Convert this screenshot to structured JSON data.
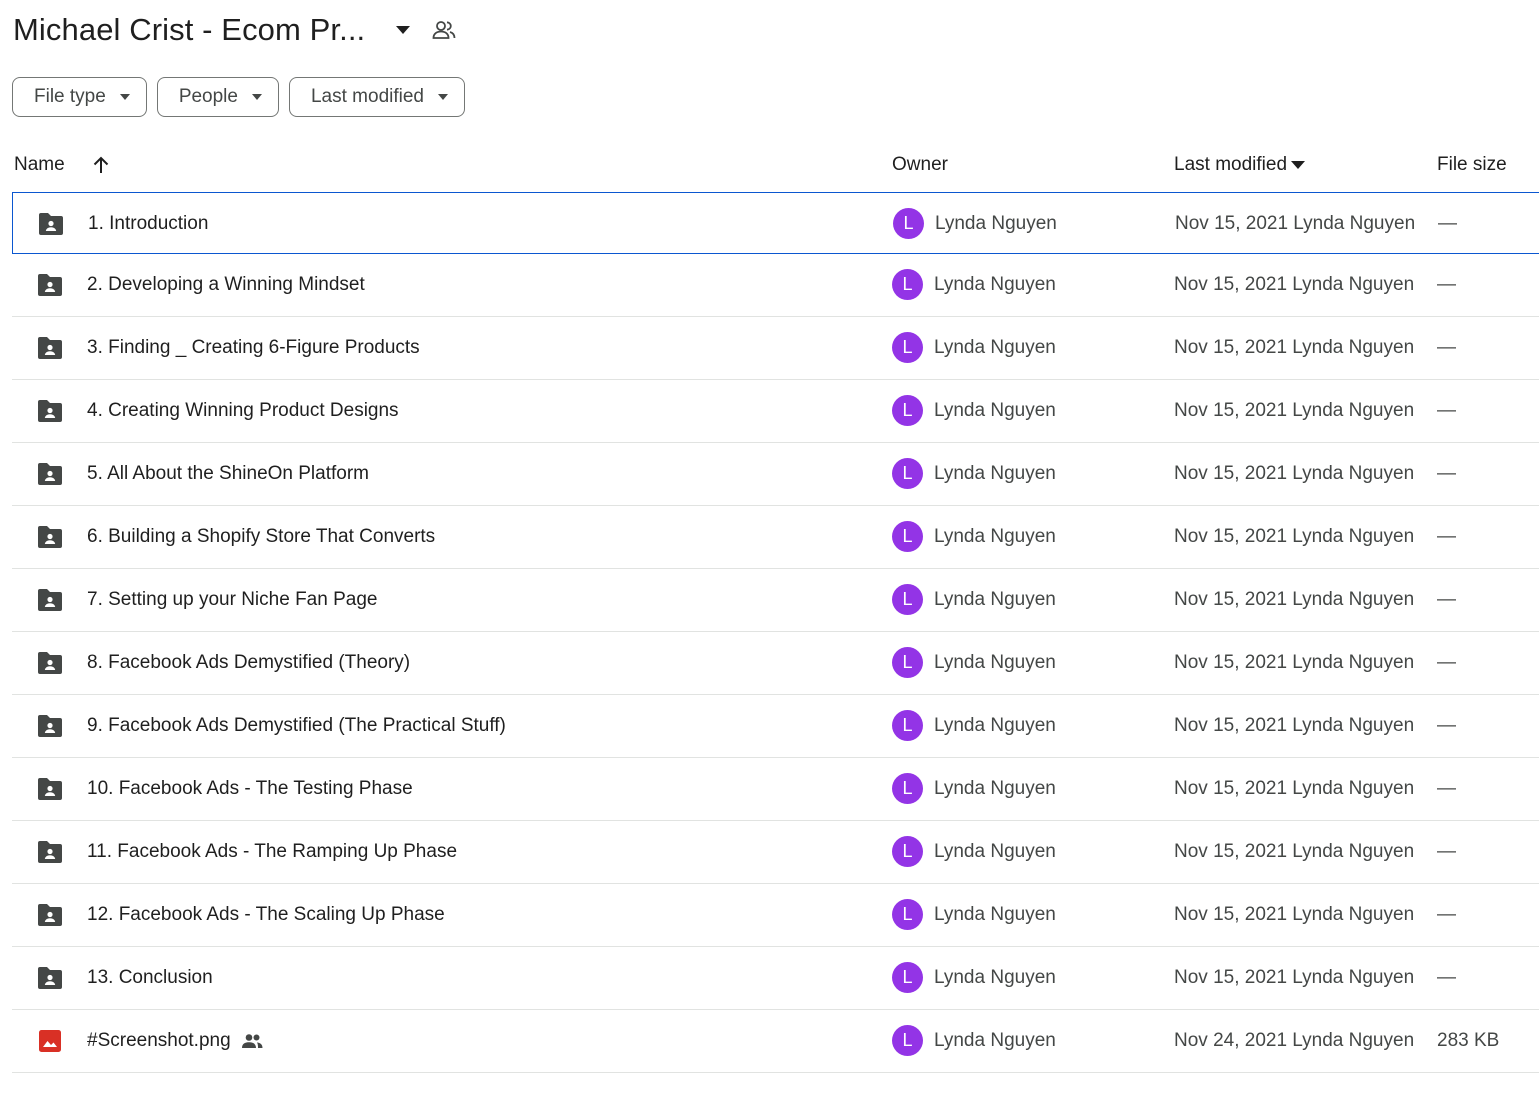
{
  "header": {
    "title": "Michael Crist - Ecom Pr..."
  },
  "filters": [
    {
      "label": "File type"
    },
    {
      "label": "People"
    },
    {
      "label": "Last modified"
    }
  ],
  "columns": {
    "name": "Name",
    "owner": "Owner",
    "last_modified": "Last modified",
    "file_size": "File size"
  },
  "colors": {
    "avatar": "#9334e6",
    "selected_border": "#0b57d0",
    "folder_icon": "#444746",
    "image_icon": "#d93025"
  },
  "rows": [
    {
      "name": "1. Introduction",
      "type": "shared-folder",
      "owner_initial": "L",
      "owner": "Lynda Nguyen",
      "modified": "Nov 15, 2021 Lynda Nguyen",
      "size": "—",
      "shared": false
    },
    {
      "name": "2. Developing a Winning Mindset",
      "type": "shared-folder",
      "owner_initial": "L",
      "owner": "Lynda Nguyen",
      "modified": "Nov 15, 2021 Lynda Nguyen",
      "size": "—",
      "shared": false
    },
    {
      "name": "3. Finding _ Creating 6-Figure Products",
      "type": "shared-folder",
      "owner_initial": "L",
      "owner": "Lynda Nguyen",
      "modified": "Nov 15, 2021 Lynda Nguyen",
      "size": "—",
      "shared": false
    },
    {
      "name": "4. Creating Winning Product Designs",
      "type": "shared-folder",
      "owner_initial": "L",
      "owner": "Lynda Nguyen",
      "modified": "Nov 15, 2021 Lynda Nguyen",
      "size": "—",
      "shared": false
    },
    {
      "name": "5. All About the ShineOn Platform",
      "type": "shared-folder",
      "owner_initial": "L",
      "owner": "Lynda Nguyen",
      "modified": "Nov 15, 2021 Lynda Nguyen",
      "size": "—",
      "shared": false
    },
    {
      "name": "6. Building a Shopify Store That Converts",
      "type": "shared-folder",
      "owner_initial": "L",
      "owner": "Lynda Nguyen",
      "modified": "Nov 15, 2021 Lynda Nguyen",
      "size": "—",
      "shared": false
    },
    {
      "name": "7. Setting up your Niche Fan Page",
      "type": "shared-folder",
      "owner_initial": "L",
      "owner": "Lynda Nguyen",
      "modified": "Nov 15, 2021 Lynda Nguyen",
      "size": "—",
      "shared": false
    },
    {
      "name": "8. Facebook Ads Demystified (Theory)",
      "type": "shared-folder",
      "owner_initial": "L",
      "owner": "Lynda Nguyen",
      "modified": "Nov 15, 2021 Lynda Nguyen",
      "size": "—",
      "shared": false
    },
    {
      "name": "9. Facebook Ads Demystified (The Practical Stuff)",
      "type": "shared-folder",
      "owner_initial": "L",
      "owner": "Lynda Nguyen",
      "modified": "Nov 15, 2021 Lynda Nguyen",
      "size": "—",
      "shared": false
    },
    {
      "name": "10. Facebook Ads - The Testing Phase",
      "type": "shared-folder",
      "owner_initial": "L",
      "owner": "Lynda Nguyen",
      "modified": "Nov 15, 2021 Lynda Nguyen",
      "size": "—",
      "shared": false
    },
    {
      "name": "11. Facebook Ads - The Ramping Up Phase",
      "type": "shared-folder",
      "owner_initial": "L",
      "owner": "Lynda Nguyen",
      "modified": "Nov 15, 2021 Lynda Nguyen",
      "size": "—",
      "shared": false
    },
    {
      "name": "12. Facebook Ads - The Scaling Up Phase",
      "type": "shared-folder",
      "owner_initial": "L",
      "owner": "Lynda Nguyen",
      "modified": "Nov 15, 2021 Lynda Nguyen",
      "size": "—",
      "shared": false
    },
    {
      "name": "13. Conclusion",
      "type": "shared-folder",
      "owner_initial": "L",
      "owner": "Lynda Nguyen",
      "modified": "Nov 15, 2021 Lynda Nguyen",
      "size": "—",
      "shared": false
    },
    {
      "name": "#Screenshot.png",
      "type": "image",
      "owner_initial": "L",
      "owner": "Lynda Nguyen",
      "modified": "Nov 24, 2021 Lynda Nguyen",
      "size": "283 KB",
      "shared": true
    }
  ]
}
